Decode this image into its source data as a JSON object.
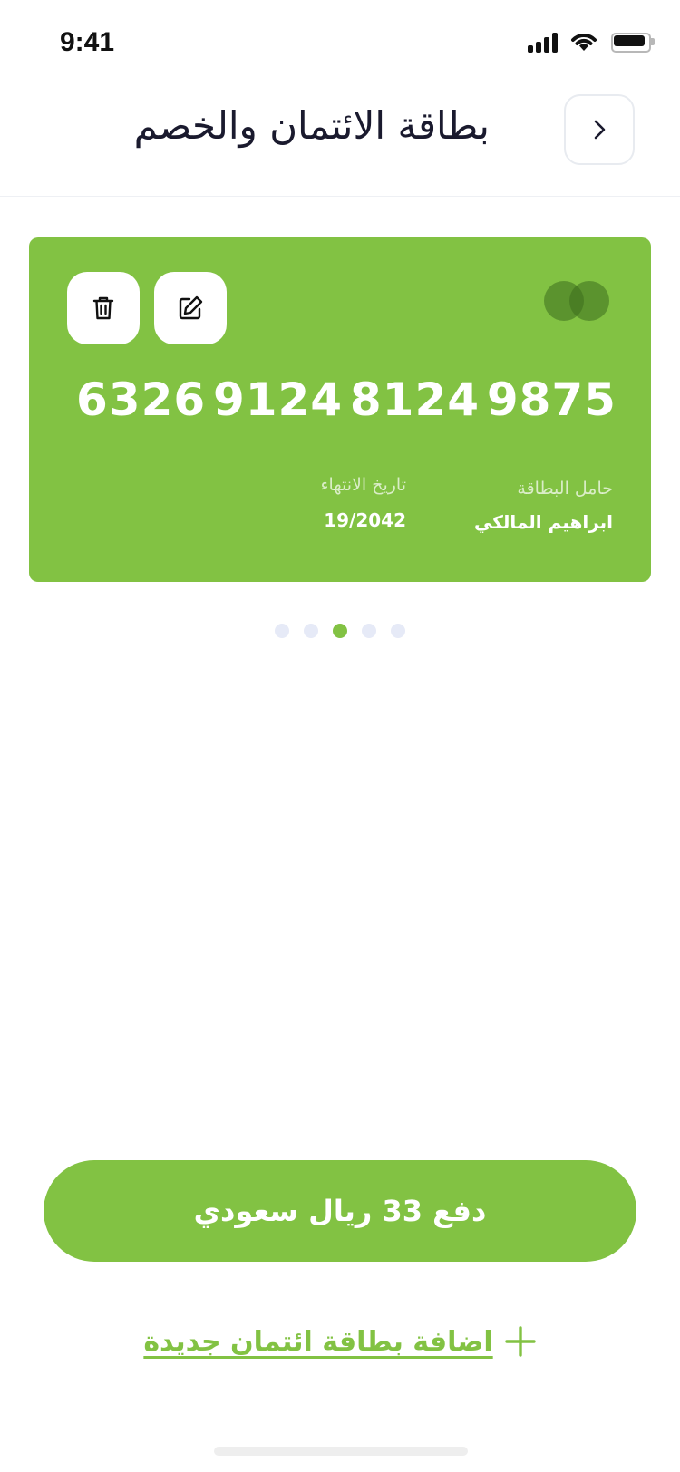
{
  "status_bar": {
    "time": "9:41"
  },
  "header": {
    "title": "بطاقة الائتمان والخصم"
  },
  "card": {
    "number_groups": [
      "6326",
      "9124",
      "8124",
      "9875"
    ],
    "expiry_label": "تاريخ الانتهاء",
    "expiry_value": "19/2042",
    "holder_label": "حامل البطاقة",
    "holder_value": "ابراهيم المالكي",
    "color": "#82c243"
  },
  "pagination": {
    "total": 5,
    "active_index": 2
  },
  "pay_button": {
    "label": "دفع 33 ريال سعودي"
  },
  "add_card": {
    "label": "اضافة بطاقة ائتمان جديدة"
  },
  "colors": {
    "accent": "#82c243",
    "title": "#1a1a2e",
    "dot_inactive": "#e6eaf7"
  },
  "icons": {
    "back": "chevron-right-icon",
    "edit": "edit-icon",
    "delete": "trash-icon",
    "add": "plus-icon",
    "brand": "card-brand-icon"
  }
}
